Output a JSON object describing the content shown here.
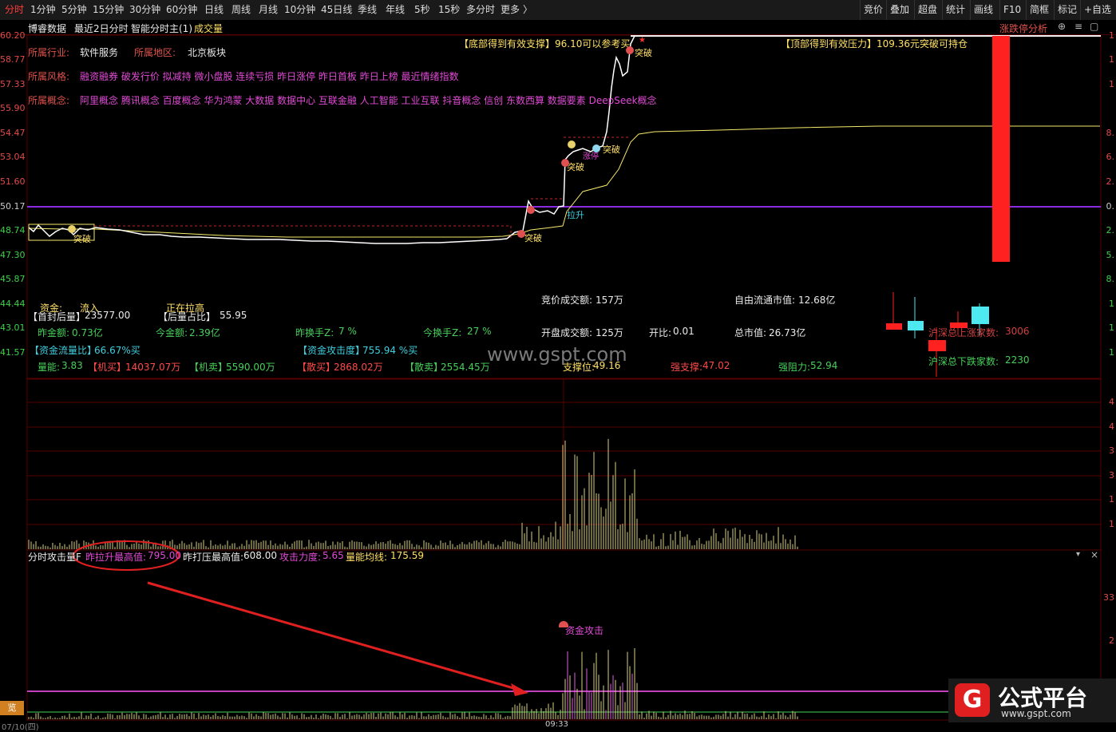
{
  "toolbar": {
    "tabs": [
      "分时",
      "1分钟",
      "5分钟",
      "15分钟",
      "30分钟",
      "60分钟",
      "日线",
      "周线",
      "月线",
      "10分钟",
      "45日线",
      "季线",
      "年线",
      "5秒",
      "15秒",
      "多分时",
      "更多"
    ],
    "more_chevron": "〉",
    "right": [
      "竞价",
      "叠加",
      "超盘",
      "统计",
      "画线",
      "F10",
      "简框",
      "标记",
      "+自选"
    ]
  },
  "infobar": {
    "stock_name": "博睿数据",
    "mode": "最近2日分时",
    "indicator": "智能分时主(1)",
    "volume": "成交量",
    "right_title": "涨跌停分析"
  },
  "y_axis_left": [
    "60.20",
    "58.77",
    "57.33",
    "55.90",
    "54.47",
    "53.04",
    "51.60",
    "50.17",
    "48.74",
    "47.30",
    "45.87",
    "44.44",
    "43.01",
    "41.57"
  ],
  "y_axis_right_top": [
    "1",
    "1",
    "1",
    "8.",
    "6.",
    "2.",
    "0.",
    "2.",
    "5.",
    "8.",
    "1",
    "1",
    "1"
  ],
  "y_axis_right_vol": [
    "4",
    "4",
    "3",
    "3",
    "1",
    "1",
    "7"
  ],
  "y_axis_right_atk": [
    "33",
    "2"
  ],
  "info": {
    "industry_label": "所属行业:",
    "industry": "软件服务",
    "region_label": "所属地区:",
    "region": "北京板块",
    "style_label": "所属风格:",
    "style": "融资融券 破发行价 拟减持 微小盘股 连续亏损 昨日涨停 昨日首板 昨日上榜 最近情绪指数",
    "concept_label": "所属概念:",
    "concept": "阿里概念 腾讯概念 百度概念 华为鸿蒙 大数据 数据中心 互联金融 人工智能 工业互联 抖音概念 信创 东数西算 数据要素 DeepSeek概念"
  },
  "signals": {
    "support_note": "【底部得到有效支撑】96.10可以参考买",
    "pressure_note": "【顶部得到有效压力】109.36元突破可持仓",
    "breakout": "突破",
    "breakout2": "突破",
    "breakout3": "突破",
    "breakout4": "突破",
    "breakout5": "突破",
    "pullup": "拉升",
    "limitup_icon": "涨停"
  },
  "stats": {
    "fund_label": "资金:",
    "fund_val": "流入",
    "rising_label": "正在拉高",
    "first_seal_label": "【首封后量】",
    "first_seal": "23577.00",
    "after_ratio_label": "【后量占比】",
    "after_ratio": "55.95",
    "auction_amount_label": "竞价成交额:",
    "auction_amount": "157万",
    "float_cap_label": "自由流通市值:",
    "float_cap": "12.68亿",
    "yest_amount_label": "昨金额:",
    "yest_amount": "0.73亿",
    "today_amount_label": "今金额:",
    "today_amount": "2.39亿",
    "yest_turnover_label": "昨换手Z:",
    "yest_turnover": "7  %",
    "today_turnover_label": "今换手Z:",
    "today_turnover": "27  %",
    "open_amount_label": "开盘成交额:",
    "open_amount": "125万",
    "open_ratio_label": "开比:",
    "open_ratio": "0.01",
    "total_cap_label": "总市值:",
    "total_cap": "26.73亿",
    "up_count_label": "沪深总上涨家数:",
    "up_count": "3006",
    "down_count_label": "沪深总下跌家数:",
    "down_count": "2230",
    "flow_ratio_label": "【资金流量比】",
    "flow_ratio": "66.67%买",
    "attack_label": "【资金攻击度】",
    "attack": "755.94 %买",
    "qn_label": "量能:",
    "qn": "3.83",
    "jm_label": "【机买】",
    "jm": "14037.07万",
    "jmc_label": "【机卖】",
    "jmc": "5590.00万",
    "sm_label": "【散买】",
    "sm": "2868.02万",
    "smc_label": "【散卖】",
    "smc": "2554.45万",
    "support_label": "支撑位:",
    "support": "49.16",
    "strong_support_label": "强支撑:",
    "strong_support": "47.02",
    "strong_resist_label": "强阻力:",
    "strong_resist": "52.94",
    "watermark": "www.gspt.com"
  },
  "attack_panel": {
    "title": "分时攻击量F",
    "max_pull_label": "昨拉升最高值:",
    "max_pull": "795.00",
    "max_press_label": "昨打压最高值:",
    "max_press": "608.00",
    "force_label": "攻击力度:",
    "force": "5.65",
    "avg_label": "量能均线:",
    "avg": "175.59",
    "fund_attack": "资金攻击",
    "bottom_left": "览",
    "bottom_date": "07/10(四)",
    "bottom_time": "09:33"
  },
  "logo": {
    "text": "公式平台",
    "url": "www.gspt.com"
  },
  "colors": {
    "price_line": "#ffffff",
    "avg_line": "#f5e96a",
    "baseline": "#8a2be2",
    "grid": "#5a0000",
    "up_bar": "#ff2020",
    "down_bar": "#4ee8f0"
  }
}
